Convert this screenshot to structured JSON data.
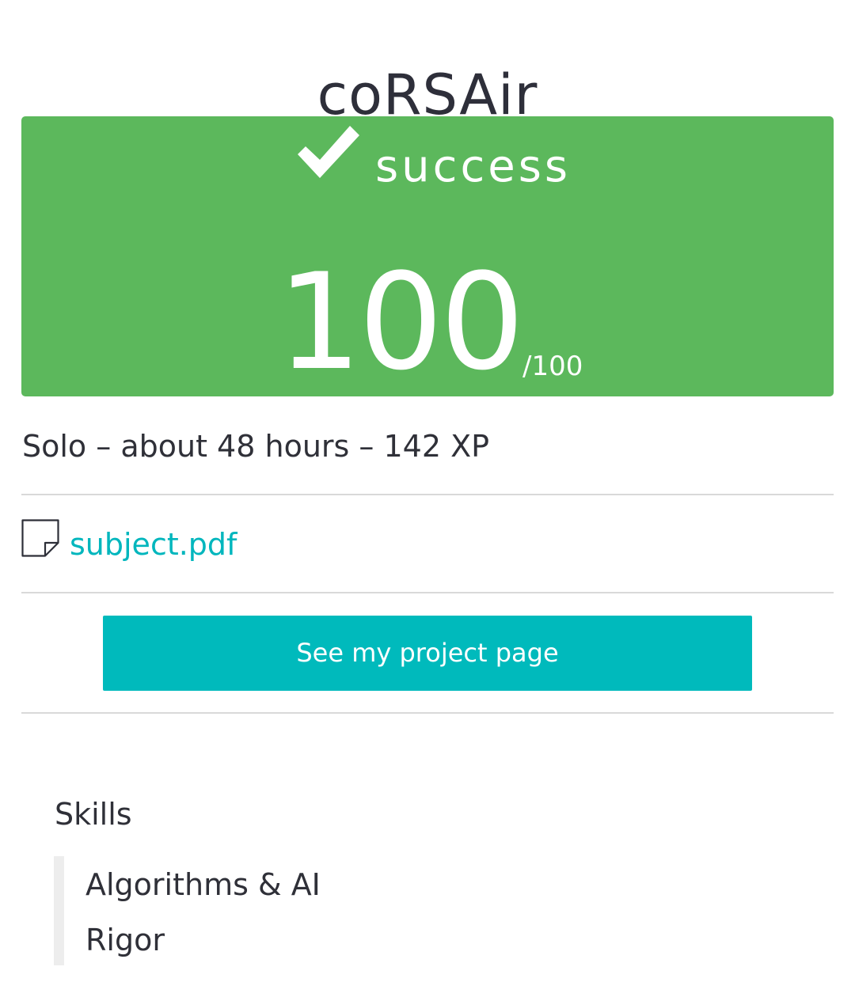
{
  "project": {
    "title": "coRSAir"
  },
  "result": {
    "status": "success",
    "score": "100",
    "score_max": "/100",
    "color": "#5cb85c",
    "icon": "checkmark-icon"
  },
  "meta": {
    "summary": "Solo – about 48 hours – 142 XP"
  },
  "subject": {
    "label": "subject.pdf",
    "icon": "file-icon",
    "color": "#00b6bd"
  },
  "actions": {
    "project_page_label": "See my project page",
    "button_color": "#00babc"
  },
  "skills": {
    "heading": "Skills",
    "items": [
      "Algorithms & AI",
      "Rigor"
    ]
  }
}
